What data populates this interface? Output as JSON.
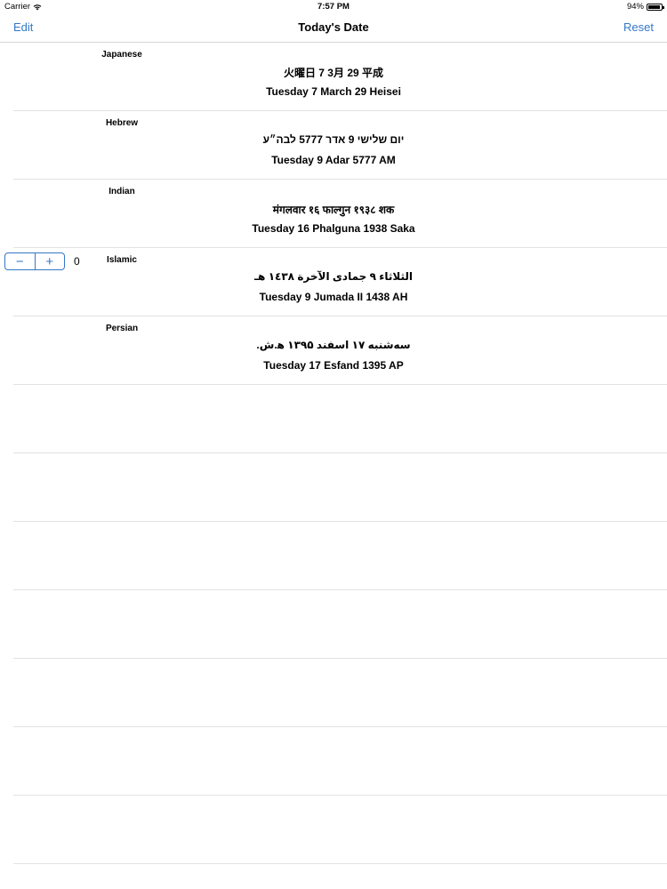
{
  "status_bar": {
    "carrier": "Carrier",
    "time": "7:57 PM",
    "battery_percent": "94%",
    "battery_level": 0.94,
    "wifi_icon": "wifi-icon",
    "battery_icon": "battery-icon"
  },
  "nav": {
    "left_button": "Edit",
    "title": "Today's Date",
    "right_button": "Reset",
    "accent_color": "#3478c8"
  },
  "stepper": {
    "minus_label": "−",
    "plus_label": "+",
    "value": "0"
  },
  "rows": [
    {
      "calendar": "Japanese",
      "native": "火曜日 7 3月 29 平成",
      "english": "Tuesday  7 March 29 Heisei"
    },
    {
      "calendar": "Hebrew",
      "native": "יום שלישי 9 אדר 5777 לבה״ע",
      "english": "Tuesday  9 Adar 5777 AM"
    },
    {
      "calendar": "Indian",
      "native": "मंगलवार १६ फाल्गुन १९३८ शक",
      "english": "Tuesday  16 Phalguna 1938 Saka"
    },
    {
      "calendar": "Islamic",
      "native": "الثلاثاء ٩ جمادى الآخرة ١٤٣٨ هـ",
      "english": "Tuesday  9 Jumada II 1438 AH"
    },
    {
      "calendar": "Persian",
      "native": "سه‌شنبه ۱۷ اسفند ۱۳۹۵ ه‍.ش.",
      "english": "Tuesday  17 Esfand 1395 AP"
    }
  ]
}
